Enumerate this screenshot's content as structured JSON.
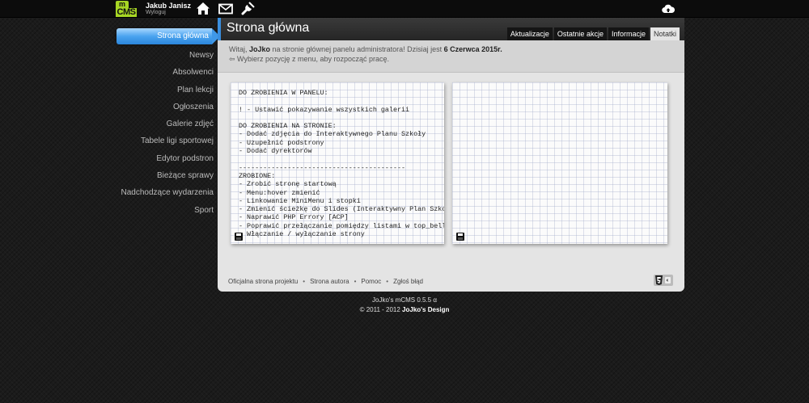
{
  "topbar": {
    "logo_top": "m",
    "logo_bottom": "CMS",
    "user_name": "Jakub Janisz",
    "logout_label": "Wyloguj",
    "icons": [
      "home-icon",
      "mail-icon",
      "tools-icon",
      "cloud-upload-icon"
    ]
  },
  "sidebar": {
    "active": "Strona główna",
    "items": [
      {
        "label": "Newsy"
      },
      {
        "label": "Absolwenci"
      },
      {
        "label": "Plan lekcji"
      },
      {
        "label": "Ogłoszenia"
      },
      {
        "label": "Galerie zdjęć"
      },
      {
        "label": "Tabele ligi sportowej"
      },
      {
        "label": "Edytor podstron"
      },
      {
        "label": "Bieżące sprawy"
      },
      {
        "label": "Nadchodzące wydarzenia"
      },
      {
        "label": "Sport"
      }
    ]
  },
  "panel": {
    "title": "Strona główna",
    "tabs": [
      {
        "label": "Aktualizacje"
      },
      {
        "label": "Ostatnie akcje"
      },
      {
        "label": "Informacje"
      },
      {
        "label": "Notatki"
      }
    ],
    "active_tab": "Notatki",
    "welcome_pre": "Witaj, ",
    "welcome_user": "JoJko",
    "welcome_mid": " na stronie głównej panelu administratora! Dzisiaj jest ",
    "welcome_date": "6 Czerwca 2015r.",
    "welcome_hint": "⇦ Wybierz pozycję z menu, aby rozpocząć pracę."
  },
  "notes": {
    "note1": "DO ZROBIENIA W PANELU:\n\n! - Ustawić pokazywanie wszystkich galerii\n\nDO ZROBIENIA NA STRONIE:\n- Dodać zdjęcia do Interaktywnego Planu Szkoły\n- Uzupełnić podstrony\n- Dodać dyrektorów\n\n-----------------------------------------\nZROBIONE:\n- Zrobić stronę startową\n- Menu:hover zmienić\n- Linkowanie MiniMenu i stopki\n- Zmienić ścieżkę do Slides (Interaktywny Plan Szkoły\n- Naprawić PHP Errory [ACP]\n- Poprawić przełączanie pomiędzy listami w top_bell [\n- Włączanie / wyłączanie strony\n- Dodać archiwum do newsów",
    "note2": ""
  },
  "footer": {
    "links": [
      {
        "label": "Oficjalna strona projektu"
      },
      {
        "label": "Strona autora"
      },
      {
        "label": "Pomoc"
      },
      {
        "label": "Zgłoś błąd"
      }
    ],
    "separator": "•"
  },
  "copyright": {
    "line1": "JoJko's mCMS 0.5.5 α",
    "line2_pre": "© 2011 - 2012 ",
    "line2_brand": "JoJko's Design"
  },
  "colors": {
    "accent": "#3a8fe0",
    "logo": "#a7d624"
  }
}
